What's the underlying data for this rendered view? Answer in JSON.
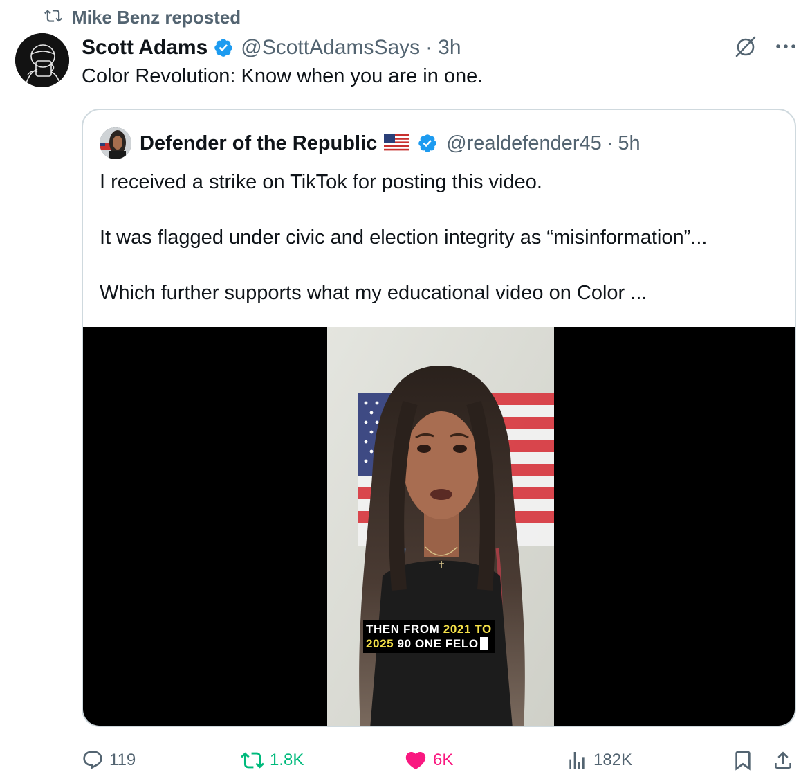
{
  "repost": {
    "label": "Mike Benz reposted",
    "icon": "repost-icon"
  },
  "post": {
    "author_name": "Scott Adams",
    "handle": "@ScottAdamsSays",
    "separator": "·",
    "time": "3h",
    "text": "Color Revolution: Know when you are in one."
  },
  "quote": {
    "author_name": "Defender of the Republic",
    "handle": "@realdefender45",
    "separator": "·",
    "time": "5h",
    "paragraphs": [
      "I received a strike on TikTok for posting this video.",
      "It was flagged under civic and election integrity as “misinformation”...",
      "Which further supports what my educational video on Color ..."
    ],
    "video": {
      "caption_line1_a": "THEN FROM ",
      "caption_line1_b": "2021 TO",
      "caption_line2_a": "2025",
      "caption_line2_b": " 90 ONE FELO"
    }
  },
  "actions": {
    "replies": "119",
    "reposts": "1.8K",
    "likes": "6K",
    "views": "182K"
  },
  "colors": {
    "verified": "#1d9bf0",
    "muted": "#536471",
    "repost_active": "#00ba7c",
    "like_active": "#f91880",
    "border": "#cfd9de"
  }
}
